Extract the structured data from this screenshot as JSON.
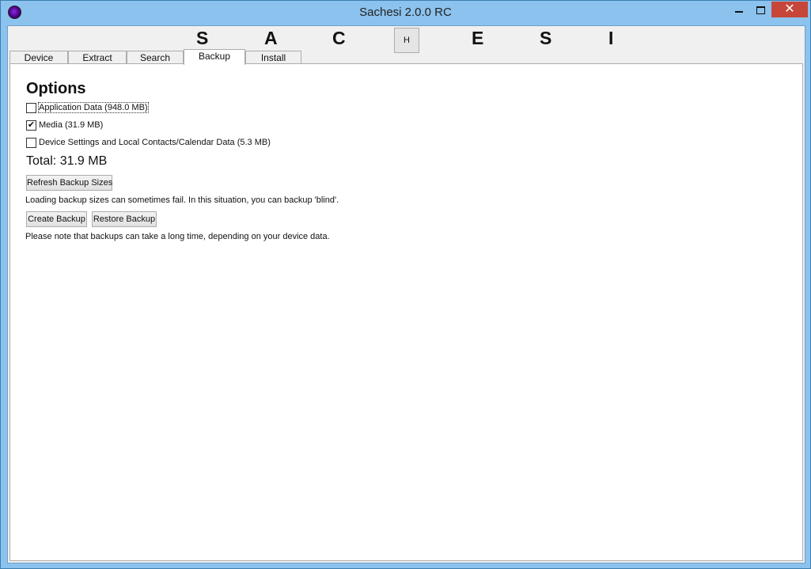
{
  "window": {
    "title": "Sachesi 2.0.0 RC",
    "minimize_glyph": "",
    "close_glyph": "✕"
  },
  "logo": {
    "letters": [
      "S",
      "A",
      "C",
      "E",
      "S",
      "I"
    ],
    "h_button": "H"
  },
  "tabs": [
    {
      "label": "Device",
      "active": false
    },
    {
      "label": "Extract",
      "active": false
    },
    {
      "label": "Search",
      "active": false
    },
    {
      "label": "Backup",
      "active": true
    },
    {
      "label": "Install",
      "active": false
    }
  ],
  "options": {
    "title": "Options",
    "items": [
      {
        "label": "Application Data (948.0 MB)",
        "checked": false
      },
      {
        "label": "Media (31.9 MB)",
        "checked": true
      },
      {
        "label": "Device Settings and Local Contacts/Calendar Data (5.3 MB)",
        "checked": false
      }
    ],
    "checked_glyph": "✔"
  },
  "total": "Total: 31.9 MB",
  "buttons": {
    "refresh": "Refresh Backup Sizes",
    "create": "Create Backup",
    "restore": "Restore Backup"
  },
  "notes": {
    "loading": "Loading backup sizes can sometimes fail. In this situation, you can backup 'blind'.",
    "duration": "Please note that backups can take a long time, depending on your device data."
  }
}
